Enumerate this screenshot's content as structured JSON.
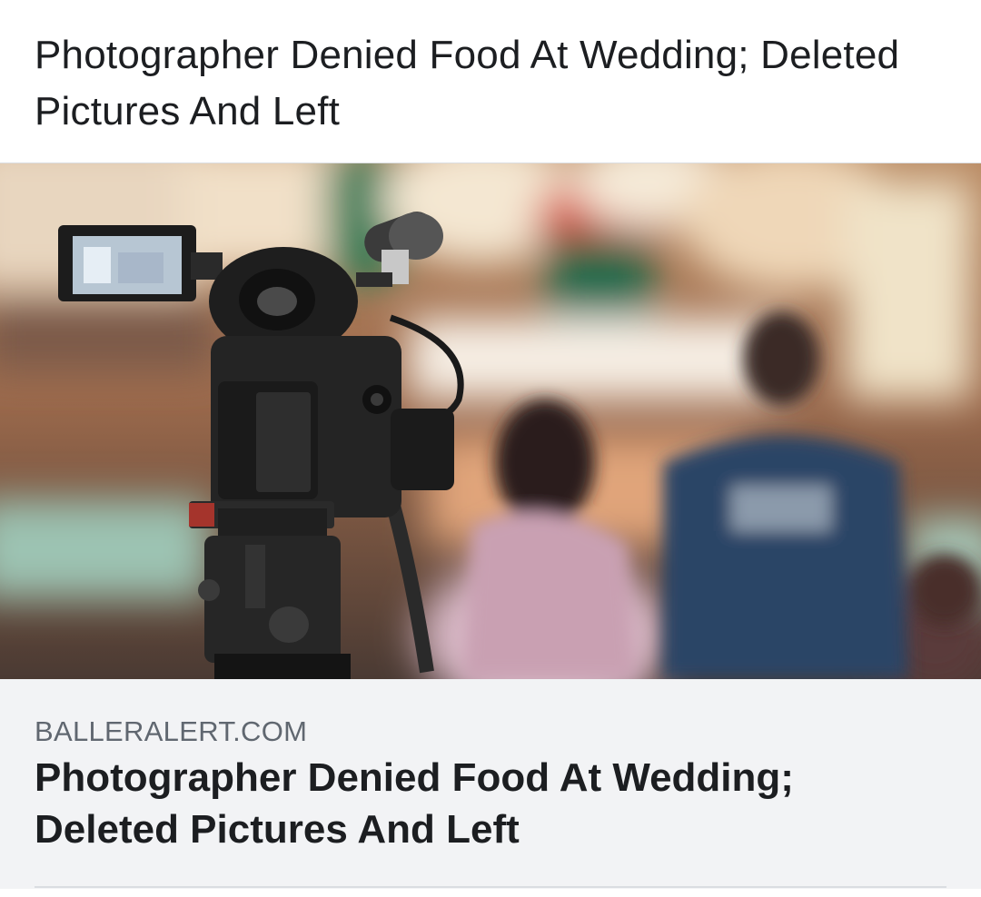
{
  "post": {
    "text": "Photographer Denied Food At Wedding; Deleted Pictures And Left"
  },
  "link_card": {
    "image": {
      "icon": "video-camera-image"
    },
    "domain": "BALLERALERT.COM",
    "title": "Photographer Denied Food At Wedding; Deleted Pictures And Left"
  },
  "colors": {
    "text_primary": "#1c1e21",
    "text_secondary": "#606770",
    "card_background": "#f2f3f5",
    "divider": "#dadde1"
  }
}
